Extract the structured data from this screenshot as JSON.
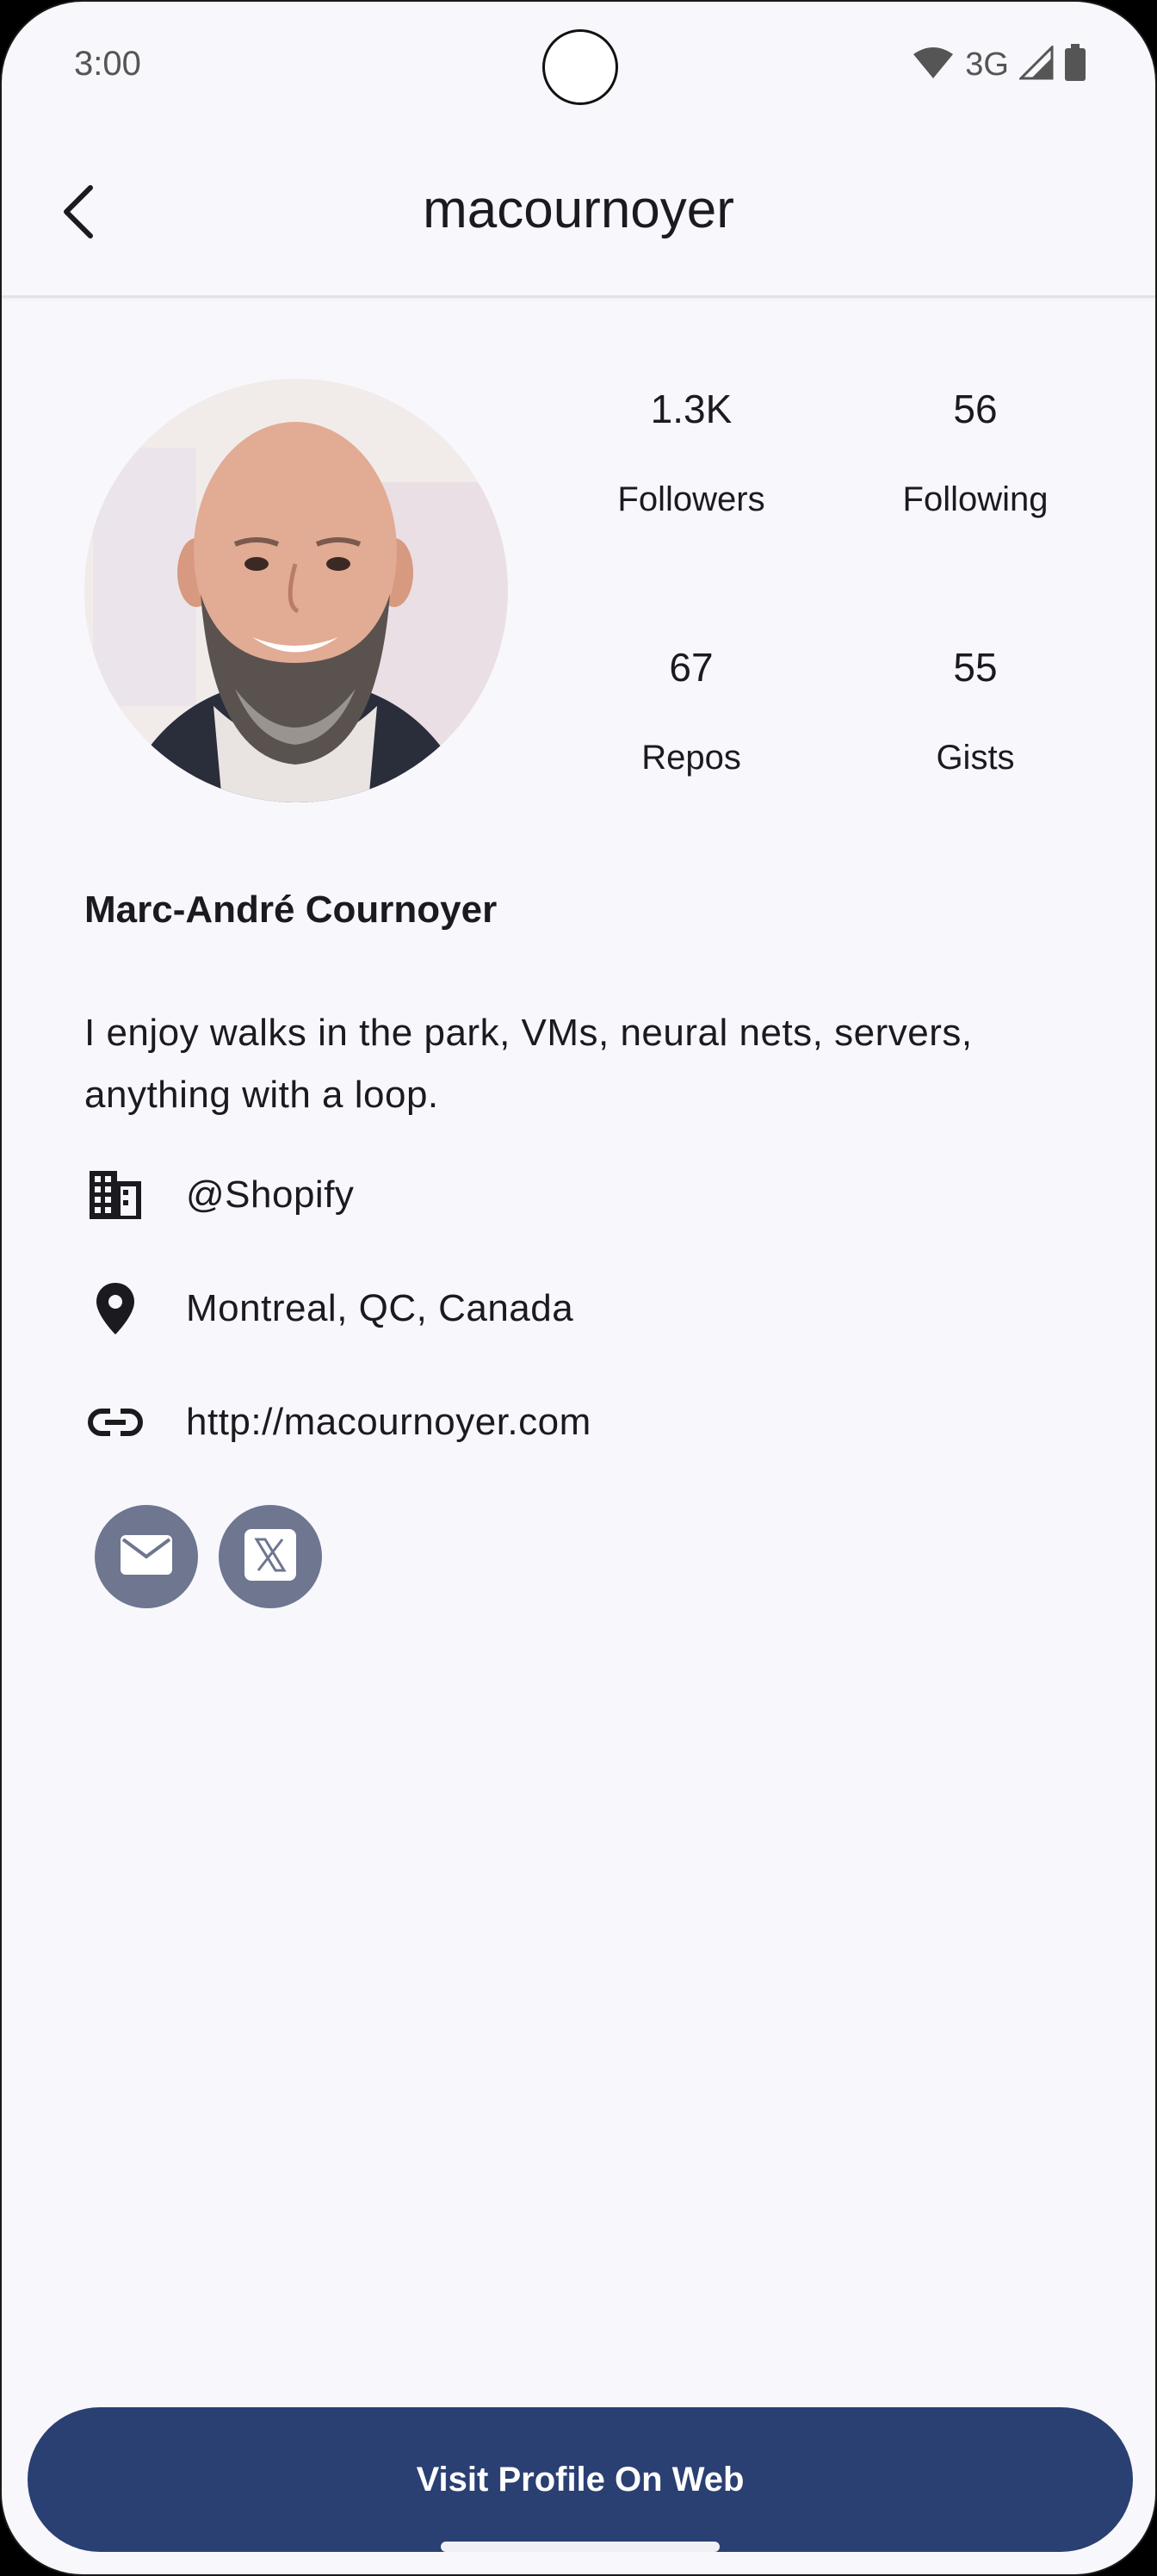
{
  "status_bar": {
    "time": "3:00",
    "network": "3G",
    "icons": [
      "wifi-icon",
      "cell-signal-icon",
      "battery-icon"
    ]
  },
  "app_bar": {
    "title": "macournoyer",
    "back_icon": "back-arrow-icon"
  },
  "profile": {
    "avatar_icon": "avatar-photo",
    "stats": {
      "followers": {
        "value": "1.3K",
        "label": "Followers"
      },
      "following": {
        "value": "56",
        "label": "Following"
      },
      "repos": {
        "value": "67",
        "label": "Repos"
      },
      "gists": {
        "value": "55",
        "label": "Gists"
      }
    },
    "name": "Marc-André Cournoyer",
    "bio": "I enjoy walks in the park, VMs, neural nets, servers, anything with a loop.",
    "company": "@Shopify",
    "location": "Montreal, QC, Canada",
    "blog": "http://macournoyer.com",
    "social": [
      "email-icon",
      "x-icon"
    ]
  },
  "actions": {
    "visit_label": "Visit Profile On Web"
  },
  "colors": {
    "background": "#f8f7fc",
    "primary_button": "#2a3f72",
    "social_button": "#6e7690",
    "text": "#1b1b1f"
  }
}
